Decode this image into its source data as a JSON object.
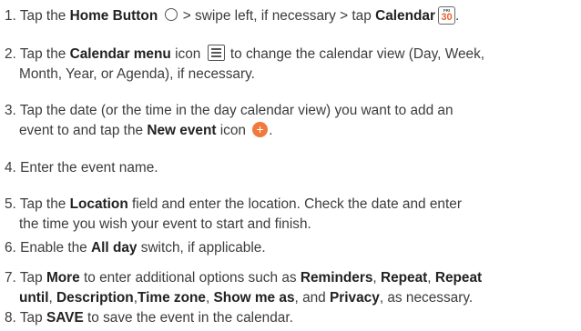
{
  "steps": [
    {
      "num": "1.",
      "t1": "Tap the ",
      "b1": "Home Button",
      "t2": " > swipe left, if necessary > tap ",
      "b2": "Calendar",
      "icon_home": "home-circle-icon",
      "icon_calendar": "calendar-app-icon",
      "calendar_icon_day": "FRI",
      "calendar_icon_date": "30"
    },
    {
      "num": "2.",
      "t1": "Tap the ",
      "b1": "Calendar menu",
      "t2": " icon ",
      "t3": " to change the calendar view (Day, Week,",
      "cont": "Month, Year, or Agenda), if necessary.",
      "icon_menu": "menu-icon"
    },
    {
      "num": "3.",
      "line1": "Tap the date (or the time in the day calendar view) you want to add an",
      "t1": "event to and tap the ",
      "b1": "New event",
      "t2": " icon ",
      "t3": ".",
      "icon_new_event": "plus-circle-icon",
      "icon_color": "#f07a3b"
    },
    {
      "num": "4.",
      "t1": "Enter the event name."
    },
    {
      "num": "5.",
      "t1": "Tap the ",
      "b1": "Location",
      "t2": " field and enter the location. Check the date and enter",
      "cont": "the time you wish your event to start and finish."
    },
    {
      "num": "6.",
      "t1": "Enable the ",
      "b1": "All day",
      "t2": " switch, if applicable."
    },
    {
      "num": "7.",
      "t1": "Tap ",
      "b1": "More",
      "t2": " to enter additional options such as ",
      "b2": "Reminders",
      "t3": ", ",
      "b3": "Repeat",
      "t4": ", ",
      "b4": "Repeat",
      "b5": "until",
      "t5": ", ",
      "b6": "Description",
      "t6": ",",
      "b7": "Time zone",
      "t7": ", ",
      "b8": "Show me as",
      "t8": ", and ",
      "b9": "Privacy",
      "t9": ", as necessary."
    },
    {
      "num": "8.",
      "t1": "Tap ",
      "b1": "SAVE",
      "t2": " to save the event in the calendar."
    }
  ]
}
